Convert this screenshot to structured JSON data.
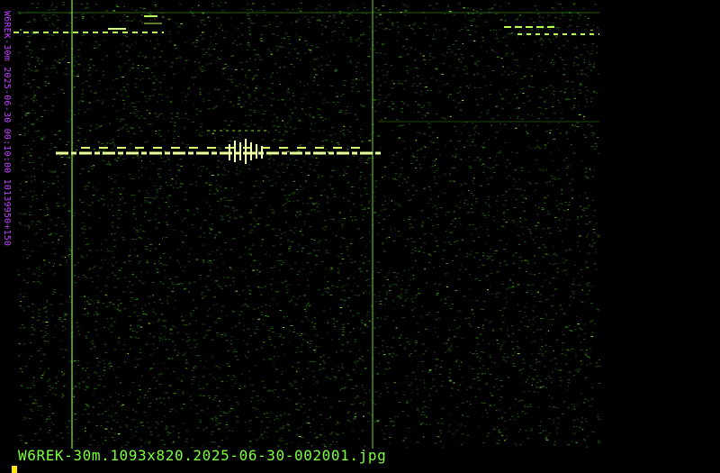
{
  "side_label": "W6REK-30m 2025-06-30 00:10:00 10139950+150",
  "file_label": "W6REK-30m.1093x820.2025-06-30-002001.jpg",
  "colors": {
    "background": "#000000",
    "signal": "#9bff33",
    "side_label": "#c040ff",
    "file_label": "#7cff3a",
    "cursor": "#ffe600"
  }
}
